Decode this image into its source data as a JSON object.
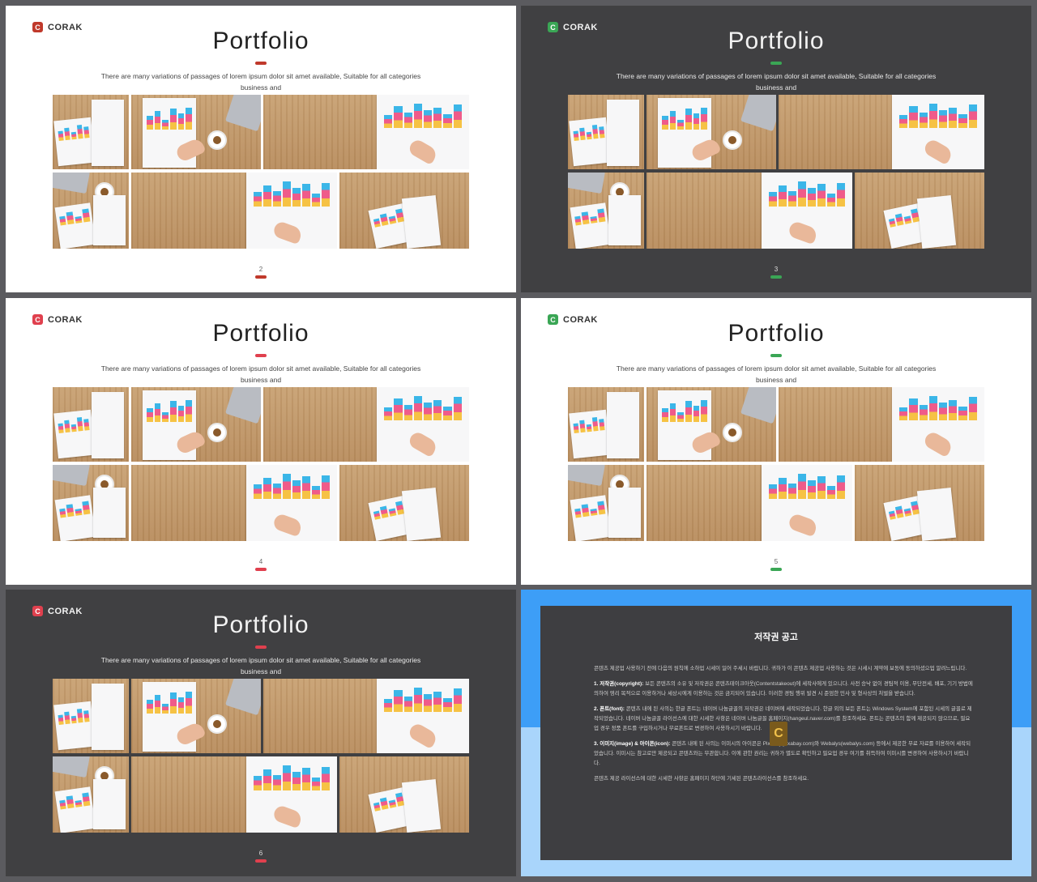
{
  "slides": [
    {
      "theme": "light",
      "logo_letter": "C",
      "logo_text": "CORAK",
      "title": "Portfolio",
      "desc_line1": "There are many variations of passages of lorem ipsum dolor sit amet available, Suitable for all categories",
      "desc_line2": "business and",
      "page": "2",
      "accent": "#c0392b"
    },
    {
      "theme": "dark",
      "logo_letter": "C",
      "logo_text": "CORAK",
      "title": "Portfolio",
      "desc_line1": "There are many variations of passages of lorem ipsum dolor sit amet available, Suitable for all categories",
      "desc_line2": "business and",
      "page": "3",
      "accent": "#3aa655"
    },
    {
      "theme": "light",
      "logo_letter": "C",
      "logo_text": "CORAK",
      "title": "Portfolio",
      "desc_line1": "There are many variations of passages of lorem ipsum dolor sit amet available, Suitable for all categories",
      "desc_line2": "business and",
      "page": "4",
      "accent": "#e0404e"
    },
    {
      "theme": "light",
      "logo_letter": "C",
      "logo_text": "CORAK",
      "title": "Portfolio",
      "desc_line1": "There are many variations of passages of lorem ipsum dolor sit amet available, Suitable for all categories",
      "desc_line2": "business and",
      "page": "5",
      "accent": "#3aa655"
    },
    {
      "theme": "dark",
      "logo_letter": "C",
      "logo_text": "CORAK",
      "title": "Portfolio",
      "desc_line1": "There are many variations of passages of lorem ipsum dolor sit amet available, Suitable for all categories",
      "desc_line2": "business and",
      "page": "6",
      "accent": "#e0404e"
    }
  ],
  "copyright": {
    "title": "저작권 공고",
    "logo_letter": "C",
    "paragraphs": [
      {
        "head": "",
        "text": "콘텐츠 제공업 사용하기 전에 다음의 원칙에 소하업 시세이 일어 주세시 바랍니다. 귀하가 이 콘텐츠 제공업 사용하는 것은 시세시 계약에 보동에 동의하셨으업 알려느립니다."
      },
      {
        "head": "1. 저작권(copyright):",
        "text": "보든 콘텐츠의 소유 및 저작권은 콘텐츠테이크아웃(Contentstakeout)에 세작사에게 있으니다. 사전 승낙 없이 경팀적 이용, 무단전세, 배포, 기기 방법에 의하여 영리 목적으로 이용하거나 세상시에게 이용하는 것은 금지되어 있습니다. 이러한 경팀 행위 발견 시 준엄한 민사 및 형사상의 처벌을 받습니다."
      },
      {
        "head": "2. 폰트(font):",
        "text": "콘텐츠 내에 된 사의는 한글 폰트는 네이버 나눔글꼴의 저작권은 네이버에 세작되었습니다. 한글 외의 보든 폰트는 Windows System에 포함된 시세의 글꼴로 제작되었습니다. 네이버 나눔글꼴 라이선스에 대한 시세한 사항은 네이버 나눔글꼴 홈페이지(hangeul.naver.com)를 참조하세요. 폰트는 콘텐츠의 함께 제공되지 않으므로, 필요업 경우 정품 폰트를 구입하시거나 무료폰트로 변경하여 사용하시기 바랍니다."
      },
      {
        "head": "3. 이미지(image) & 아이콘(icon):",
        "text": "콘텐츠 내에 된 사의는 이미시의 아이콘은 Pixabay(pixabay.com)와 Webalys(webalys.com) 등에서 제공한 무료 자료를 이용하여 세작되었습니다. 이미시는 참고로만 제공되고 콘텐츠와는 무관합니다. 이에 관한 권리는 귀하가 별도로 확인하고 필요업 경우 여기를 취득하여 이미시를 변경하여 사용하시기 바랍니다."
      },
      {
        "head": "",
        "text": "콘텐츠 제공 라이선스에 대한 시세한 사항은 홈페이지 하단에 기세된 콘텐츠라이선스를 참조하세요."
      }
    ]
  }
}
